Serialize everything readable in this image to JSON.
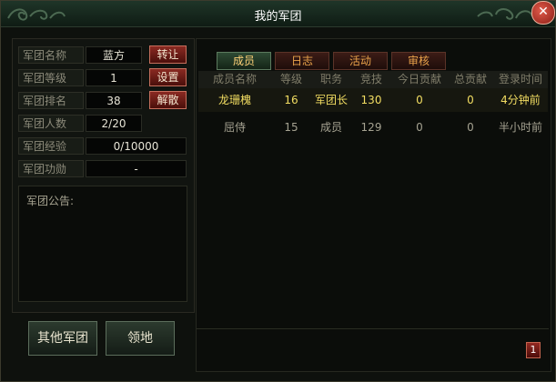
{
  "window": {
    "title": "我的军团"
  },
  "info": {
    "name_label": "军团名称",
    "name_value": "蓝方",
    "transfer_btn": "转让",
    "level_label": "军团等级",
    "level_value": "1",
    "settings_btn": "设置",
    "rank_label": "军团排名",
    "rank_value": "38",
    "disband_btn": "解散",
    "count_label": "军团人数",
    "count_value": "2/20",
    "exp_label": "军团经验",
    "exp_value": "0/10000",
    "merit_label": "军团功勋",
    "merit_value": "-"
  },
  "notice": {
    "label": "军团公告:"
  },
  "buttons": {
    "other_legions": "其他军团",
    "territory": "领地"
  },
  "tabs": [
    {
      "label": "成员",
      "active": true
    },
    {
      "label": "日志",
      "active": false
    },
    {
      "label": "活动",
      "active": false
    },
    {
      "label": "审核",
      "active": false
    }
  ],
  "table": {
    "headers": [
      "成员名称",
      "等级",
      "职务",
      "竞技",
      "今日贡献",
      "总贡献",
      "登录时间"
    ],
    "rows": [
      [
        "龙珊槐",
        "16",
        "军团长",
        "130",
        "0",
        "0",
        "4分钟前"
      ],
      [
        "屈侍",
        "15",
        "成员",
        "129",
        "0",
        "0",
        "半小时前"
      ]
    ]
  },
  "pagination": {
    "current": "1"
  },
  "colors": {
    "highlight": "#f2dd62",
    "tab_text": "#e8a24a",
    "close": "#b83222"
  },
  "icons": {
    "close": "close-icon",
    "decor": "cloud-swirl-icon"
  }
}
